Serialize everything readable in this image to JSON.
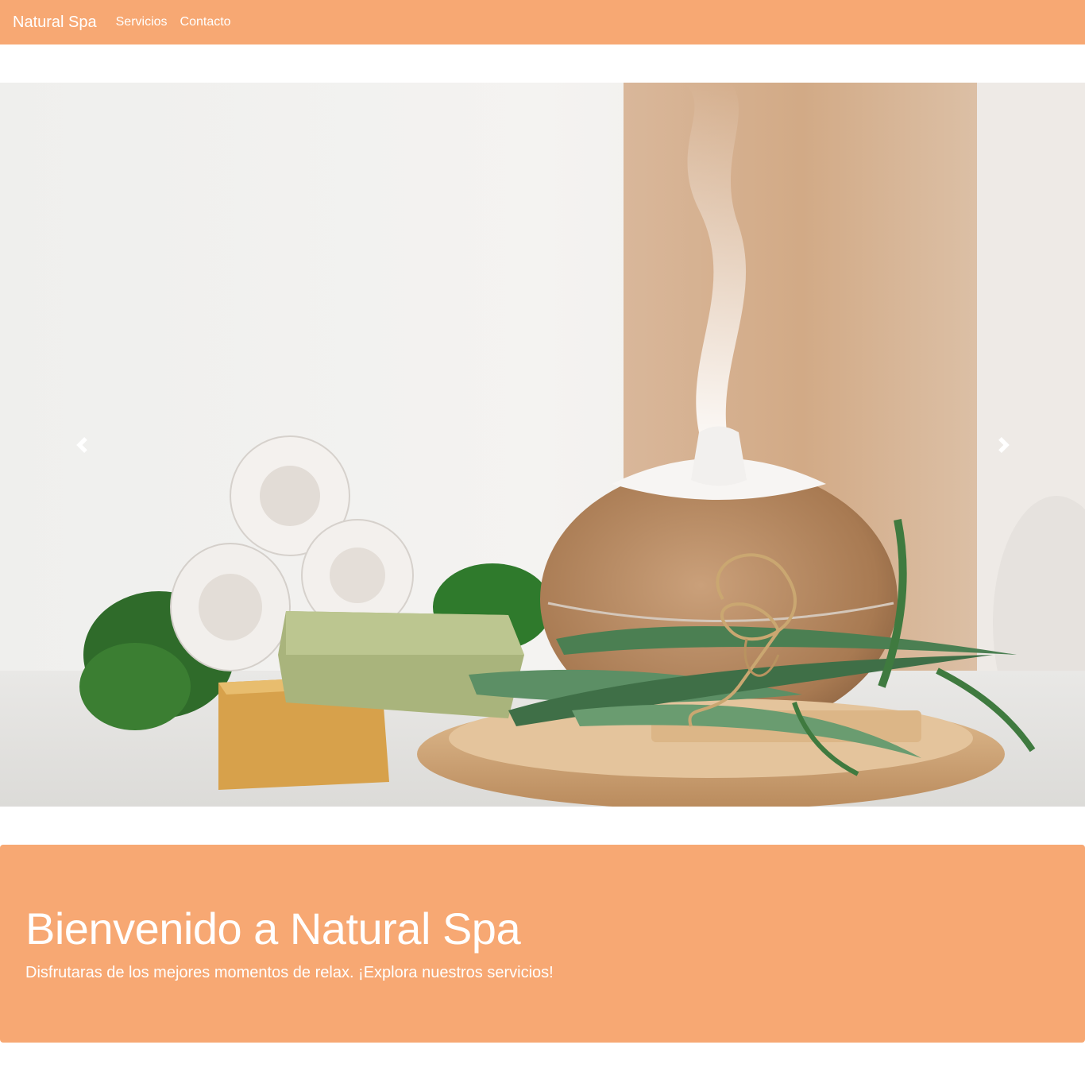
{
  "navbar": {
    "brand": "Natural Spa",
    "links": [
      "Servicios",
      "Contacto"
    ],
    "bg_color": "#f7a873"
  },
  "carousel": {
    "image_alt": "spa scene with towels, soaps, aloe vera and aroma diffuser",
    "prev_icon": "chevron-left-icon",
    "next_icon": "chevron-right-icon"
  },
  "jumbotron": {
    "title": "Bienvenido a Natural Spa",
    "lead": "Disfrutaras de los mejores momentos de relax. ¡Explora nuestros servicios!",
    "bg_color": "#f7a873"
  }
}
